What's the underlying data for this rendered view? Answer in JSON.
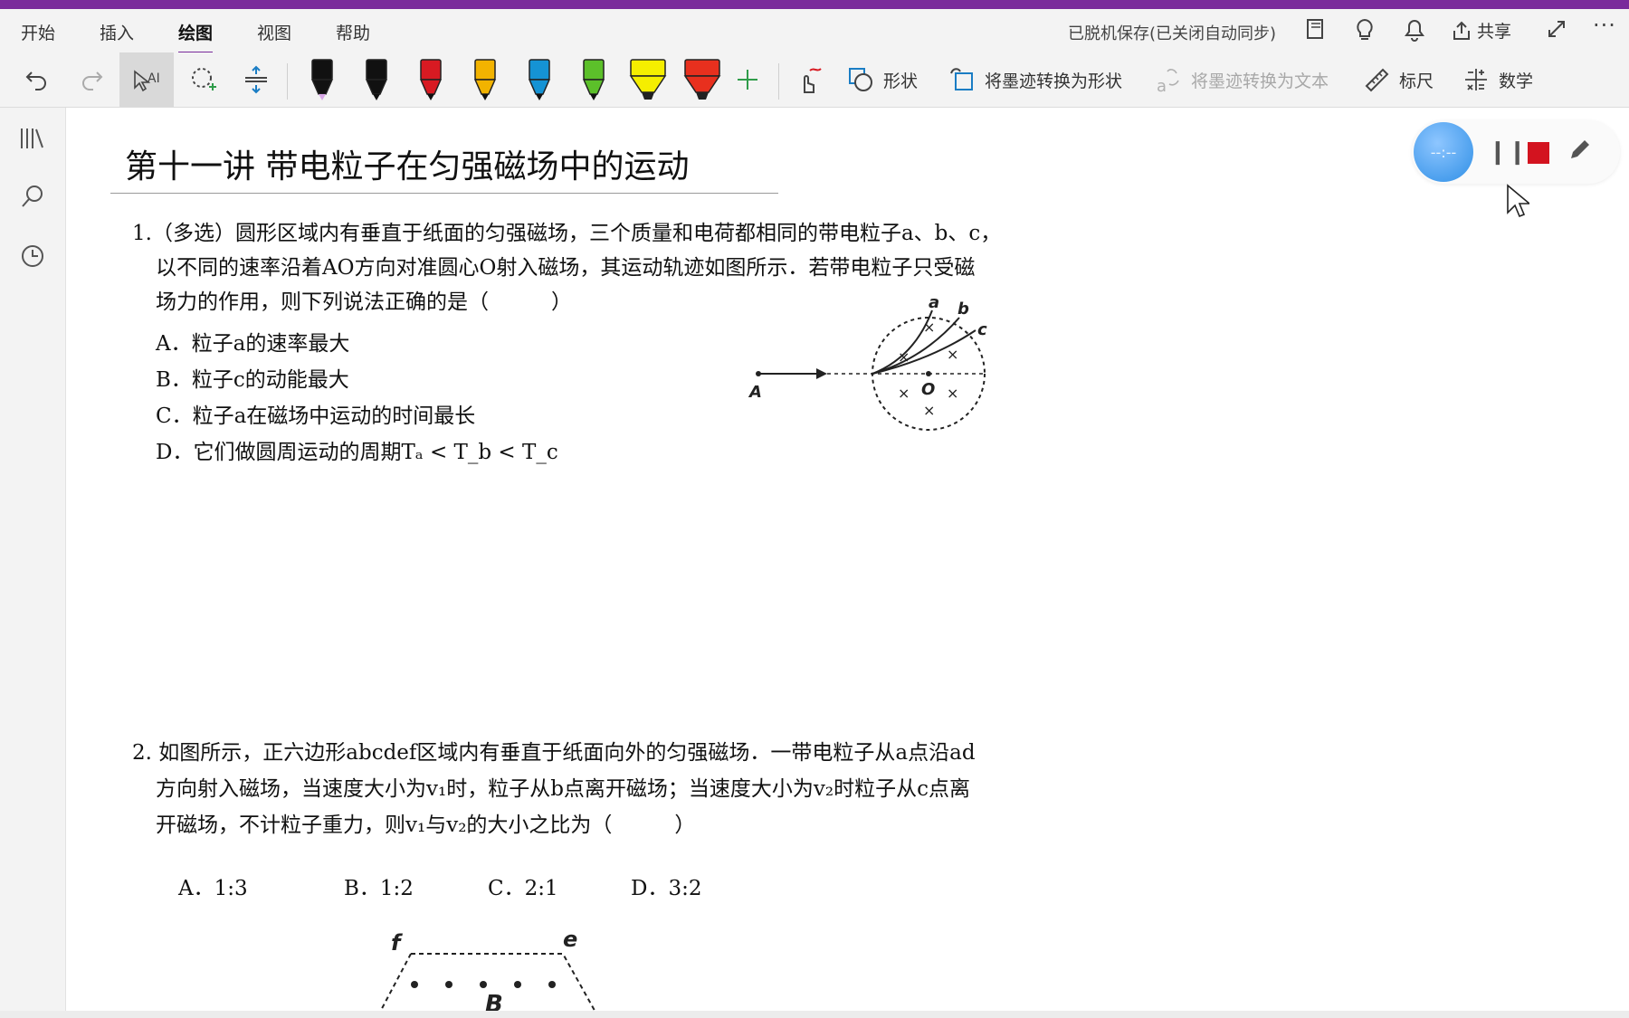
{
  "menu": {
    "tabs": [
      "开始",
      "插入",
      "绘图",
      "视图",
      "帮助"
    ],
    "active_tab": "绘图",
    "status": "已脱机保存(已关闭自动同步)",
    "share_label": "共享"
  },
  "toolbar": {
    "shapes_label": "形状",
    "ink_to_shape_label": "将墨迹转换为形状",
    "ink_to_text_label": "将墨迹转换为文本",
    "ruler_label": "标尺",
    "math_label": "数学",
    "pens": [
      {
        "name": "pen-black-lilac",
        "body": "#111111",
        "tip": "#d7a6e6"
      },
      {
        "name": "pen-black",
        "body": "#111111",
        "tip": "#111111"
      },
      {
        "name": "pen-red",
        "body": "#d81a22",
        "tip": "#111111"
      },
      {
        "name": "pencil-orange",
        "body": "#f2b300",
        "tip": "#111111"
      },
      {
        "name": "pen-blue",
        "body": "#1593d4",
        "tip": "#111111"
      },
      {
        "name": "pen-green",
        "body": "#5cc02a",
        "tip": "#111111"
      },
      {
        "name": "highlighter-yellow",
        "body": "#f5ee00",
        "tip": "#f5ee00"
      },
      {
        "name": "highlighter-red",
        "body": "#e8301e",
        "tip": "#e8301e"
      }
    ]
  },
  "recorder": {
    "timer": "--:--"
  },
  "page": {
    "title": "第十一讲 带电粒子在匀强磁场中的运动",
    "q1": {
      "line1": "1.（多选）圆形区域内有垂直于纸面的匀强磁场，三个质量和电荷都相同的带电粒子a、b、c，",
      "line2": "以不同的速率沿着AO方向对准圆心O射入磁场，其运动轨迹如图所示．若带电粒子只受磁",
      "line3": "场力的作用，则下列说法正确的是（　　　）",
      "options": [
        "A．粒子a的速率最大",
        "B．粒子c的动能最大",
        "C．粒子a在磁场中运动的时间最长",
        "D．它们做圆周运动的周期Tₐ < T_b < T_c"
      ],
      "figure_labels": {
        "A": "A",
        "O": "O",
        "a": "a",
        "b": "b",
        "c": "c"
      }
    },
    "q2": {
      "line1": "2. 如图所示，正六边形abcdef区域内有垂直于纸面向外的匀强磁场．一带电粒子从a点沿ad",
      "line2": "方向射入磁场，当速度大小为v₁时，粒子从b点离开磁场；当速度大小为v₂时粒子从c点离",
      "line3": "开磁场，不计粒子重力，则v₁与v₂的大小之比为（　　　）",
      "options": [
        "A．1:3",
        "B．1:2",
        "C．2:1",
        "D．3:2"
      ],
      "figure_labels": {
        "f": "f",
        "e": "e",
        "B": "B"
      }
    }
  }
}
